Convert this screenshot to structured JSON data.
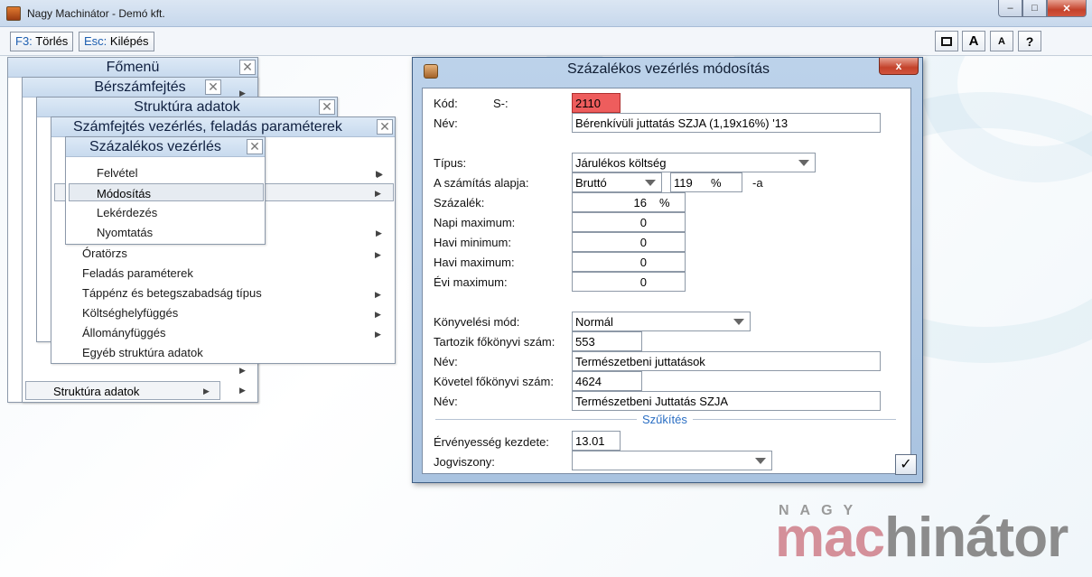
{
  "window": {
    "title": "Nagy Machinátor - Demó kft."
  },
  "toolbar": {
    "delete_key": "F3:",
    "delete_label": "Törlés",
    "exit_key": "Esc:",
    "exit_label": "Kilépés",
    "btn_window": "",
    "btn_font_big": "A",
    "btn_font_small": "A",
    "btn_help": "?"
  },
  "panels": {
    "fomenu": "Főmenü",
    "berszam": "Bérszámfejtés",
    "struktura": "Struktúra adatok",
    "szamfejtes": "Számfejtés vezérlés, feladás paraméterek",
    "szazalekos": "Százalékos vezérlés"
  },
  "submenu": [
    "Felvétel",
    "Módosítás",
    "Lekérdezés",
    "Nyomtatás"
  ],
  "struktura_items": [
    "Óratörzs",
    "Feladás paraméterek",
    "Táppénz és betegszabadság típus",
    "Költséghelyfüggés",
    "Állományfüggés",
    "Egyéb struktúra adatok"
  ],
  "berszam_bottom": "Struktúra adatok",
  "dialog": {
    "title": "Százalékos vezérlés módosítás",
    "close": "x",
    "kod_label": "Kód:",
    "kod_prefix": "S-:",
    "kod_value": "2110",
    "nev_label": "Név:",
    "nev_value": "Bérenkívüli juttatás SZJA (1,19x16%) '13",
    "tipus_label": "Típus:",
    "tipus_value": "Járulékos költség",
    "alap_label": "A számítás alapja:",
    "alap_value": "Bruttó",
    "alap_pct": "119",
    "alap_pct_sign": "%",
    "alap_suffix": "-a",
    "szazalek_label": "Százalék:",
    "szazalek_value": "16",
    "szazalek_sign": "%",
    "napi_max_label": "Napi maximum:",
    "napi_max_value": "0",
    "havi_min_label": "Havi minimum:",
    "havi_min_value": "0",
    "havi_max_label": "Havi maximum:",
    "havi_max_value": "0",
    "evi_max_label": "Évi maximum:",
    "evi_max_value": "0",
    "konyv_mod_label": "Könyvelési mód:",
    "konyv_mod_value": "Normál",
    "tartozik_label": "Tartozik főkönyvi szám:",
    "tartozik_value": "553",
    "tartozik_nev_label": "Név:",
    "tartozik_nev_value": "Természetbeni juttatások",
    "kovetel_label": "Követel főkönyvi szám:",
    "kovetel_value": "4624",
    "kovetel_nev_label": "Név:",
    "kovetel_nev_value": "Természetbeni Juttatás SZJA",
    "szukites": "Szűkítés",
    "ervenyes_label": "Érvényesség kezdete:",
    "ervenyes_value": "13.01",
    "jogviszony_label": "Jogviszony:",
    "jogviszony_value": "",
    "ok": "✓"
  },
  "logo": {
    "small": "NAGY",
    "big_a": "mac",
    "big_b": "hinátor"
  },
  "colors": {
    "accent": "#2b6fc4",
    "code_field": "#ee5d5d"
  }
}
